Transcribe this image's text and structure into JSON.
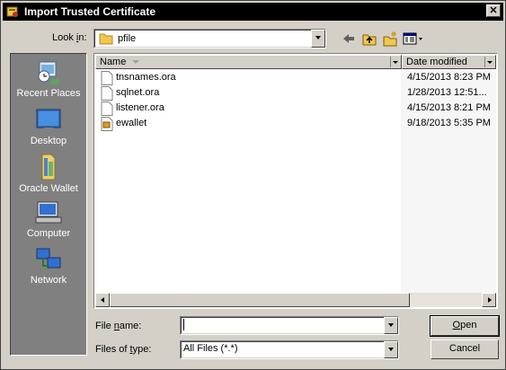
{
  "window": {
    "title": "Import Trusted Certificate",
    "close_glyph": "✕"
  },
  "lookin": {
    "label_pre": "Look ",
    "label_u": "i",
    "label_post": "n:",
    "value": "pfile"
  },
  "toolbar": [
    "back-arrow-icon",
    "up-folder-icon",
    "new-folder-icon",
    "view-menu-icon"
  ],
  "places": [
    {
      "label": "Recent Places",
      "icon": "recent-places-icon"
    },
    {
      "label": "Desktop",
      "icon": "desktop-icon"
    },
    {
      "label": "Oracle Wallet",
      "icon": "oracle-wallet-folder-icon"
    },
    {
      "label": "Computer",
      "icon": "computer-icon"
    },
    {
      "label": "Network",
      "icon": "network-icon"
    }
  ],
  "columns": {
    "name": "Name",
    "date": "Date modified"
  },
  "files": [
    {
      "name": "tnsnames.ora",
      "date": "4/15/2013 8:23 PM",
      "icon": "file-icon"
    },
    {
      "name": "sqlnet.ora",
      "date": "1/28/2013 12:51...",
      "icon": "file-icon"
    },
    {
      "name": "listener.ora",
      "date": "4/15/2013 8:21 PM",
      "icon": "file-icon"
    },
    {
      "name": "ewallet",
      "date": "9/18/2013 5:35 PM",
      "icon": "wallet-file-icon"
    }
  ],
  "filename": {
    "label_pre": "File ",
    "label_u": "n",
    "label_post": "ame:",
    "value": ""
  },
  "filetype": {
    "label_pre": "Files of ",
    "label_u": "t",
    "label_post": "ype:",
    "value": "All Files (*.*)"
  },
  "buttons": {
    "open_u": "O",
    "open_rest": "pen",
    "cancel": "Cancel"
  }
}
